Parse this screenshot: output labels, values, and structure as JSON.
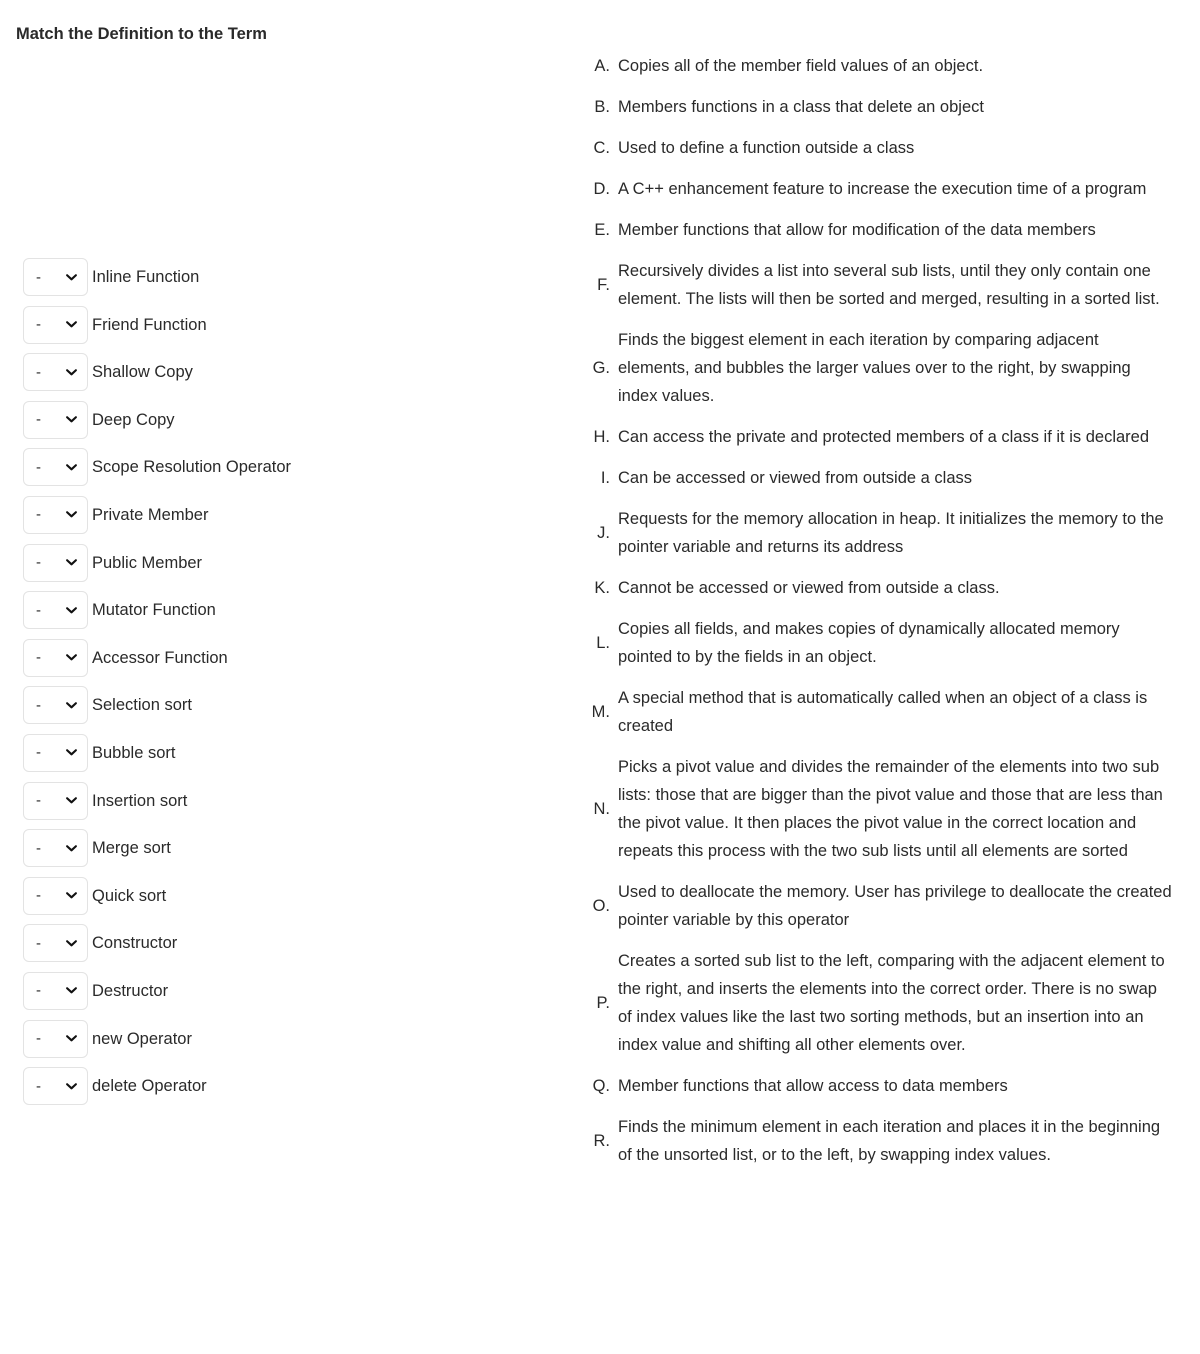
{
  "page": {
    "title": "Match the Definition to the Term"
  },
  "terms": {
    "select_placeholder": "-",
    "items": [
      {
        "label": "Inline Function",
        "value": "-"
      },
      {
        "label": "Friend Function",
        "value": "-"
      },
      {
        "label": "Shallow Copy",
        "value": "-"
      },
      {
        "label": "Deep Copy",
        "value": "-"
      },
      {
        "label": "Scope Resolution Operator",
        "value": "-"
      },
      {
        "label": "Private Member",
        "value": "-"
      },
      {
        "label": "Public Member",
        "value": "-"
      },
      {
        "label": "Mutator Function",
        "value": "-"
      },
      {
        "label": "Accessor Function",
        "value": "-"
      },
      {
        "label": "Selection sort",
        "value": "-"
      },
      {
        "label": "Bubble sort",
        "value": "-"
      },
      {
        "label": "Insertion sort",
        "value": "-"
      },
      {
        "label": "Merge sort",
        "value": "-"
      },
      {
        "label": "Quick sort",
        "value": "-"
      },
      {
        "label": "Constructor",
        "value": "-"
      },
      {
        "label": "Destructor",
        "value": "-"
      },
      {
        "label": "new Operator",
        "value": "-"
      },
      {
        "label": "delete Operator",
        "value": "-"
      }
    ]
  },
  "definitions": {
    "items": [
      {
        "letter": "A.",
        "text": "Copies all of the member field values of an object."
      },
      {
        "letter": "B.",
        "text": "Members functions in a class that delete an object"
      },
      {
        "letter": "C.",
        "text": "Used to define a function outside a class"
      },
      {
        "letter": "D.",
        "text": "A C++ enhancement feature to increase the execution time of a program"
      },
      {
        "letter": "E.",
        "text": "Member functions that allow for modification of the data members"
      },
      {
        "letter": "F.",
        "text": "Recursively divides a list into several sub lists, until they only contain one element. The lists will then be sorted and merged, resulting in a sorted list."
      },
      {
        "letter": "G.",
        "text": "Finds the biggest element in each iteration by comparing adjacent elements, and bubbles the larger values over to the right, by swapping index values."
      },
      {
        "letter": "H.",
        "text": "Can access the private and protected members of a class if it is declared"
      },
      {
        "letter": "I.",
        "text": "Can be accessed or viewed from outside a class"
      },
      {
        "letter": "J.",
        "text": "Requests for the memory allocation in heap. It initializes the memory to the pointer variable and returns its address"
      },
      {
        "letter": "K.",
        "text": "Cannot be accessed or viewed from outside a class."
      },
      {
        "letter": "L.",
        "text": "Copies all fields, and makes copies of dynamically allocated memory pointed to by the fields in an object."
      },
      {
        "letter": "M.",
        "text": "A special method that is automatically called when an object of a class is created"
      },
      {
        "letter": "N.",
        "text": "Picks a pivot value and divides the remainder of the elements into two sub lists: those that are bigger than the pivot value and those that are less than the pivot value. It then places the pivot value in the correct location and repeats this process with the two sub lists until all elements are sorted"
      },
      {
        "letter": "O.",
        "text": "Used to deallocate the memory. User has privilege to deallocate the created pointer variable by this operator"
      },
      {
        "letter": "P.",
        "text": "Creates a sorted sub list to the left, comparing with the adjacent element to the right, and inserts the elements into the correct order. There is no swap of index values like the last two sorting methods, but an insertion into an index value and shifting all other elements over."
      },
      {
        "letter": "Q.",
        "text": "Member functions that allow access to data members"
      },
      {
        "letter": "R.",
        "text": "Finds the minimum element in each iteration and places it in the beginning of the unsorted list, or to the left, by swapping index values."
      }
    ]
  },
  "colors": {
    "text": "#2a2a2a",
    "select_border": "#e3e3e3",
    "background": "#ffffff"
  }
}
